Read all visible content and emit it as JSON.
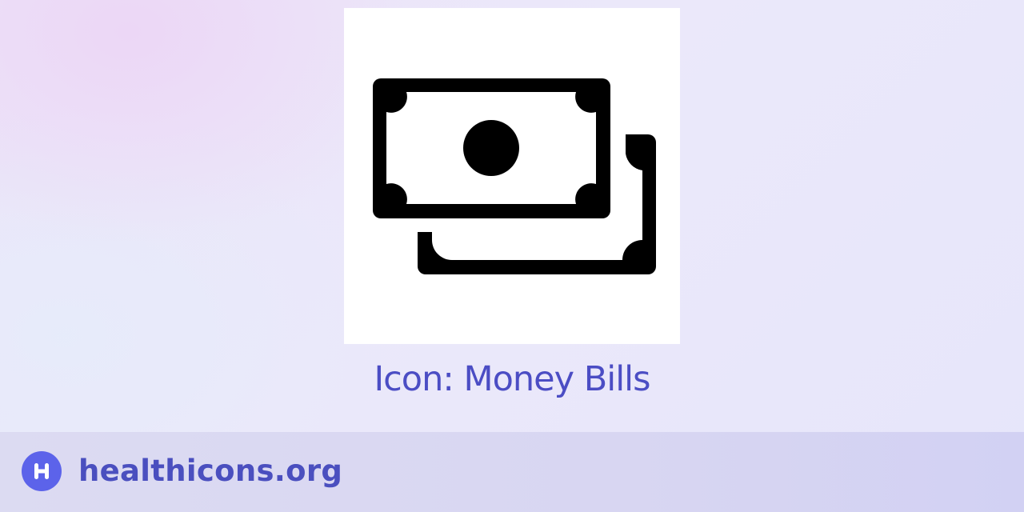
{
  "icon": {
    "name": "money-bills-icon",
    "title": "Icon: Money Bills"
  },
  "footer": {
    "logo_icon": "healthicons-logo-icon",
    "site_name": "healthicons.org"
  },
  "colors": {
    "accent": "#4b4dc4",
    "logo": "#5c63ea",
    "icon_fill": "#000000"
  }
}
